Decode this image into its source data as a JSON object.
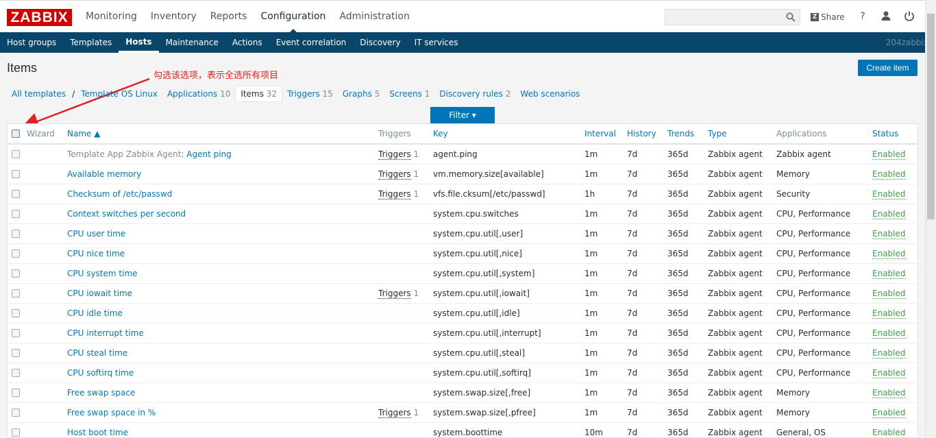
{
  "logo": "ZABBIX",
  "main_nav": [
    "Monitoring",
    "Inventory",
    "Reports",
    "Configuration",
    "Administration"
  ],
  "main_nav_active": "Configuration",
  "search": {
    "value": "",
    "placeholder": ""
  },
  "share_label": "Share",
  "help_label": "?",
  "sub_nav": [
    "Host groups",
    "Templates",
    "Hosts",
    "Maintenance",
    "Actions",
    "Event correlation",
    "Discovery",
    "IT services"
  ],
  "sub_nav_active": "Hosts",
  "server_name": "204zabbix",
  "page_title": "Items",
  "annotation": "勾选该选项，表示全选所有项目",
  "create_button": "Create item",
  "breadcrumb": {
    "all_templates": "All templates",
    "separator": "/",
    "template": "Template OS Linux"
  },
  "tabs": [
    {
      "label": "Applications",
      "count": "10"
    },
    {
      "label": "Items",
      "count": "32"
    },
    {
      "label": "Triggers",
      "count": "15"
    },
    {
      "label": "Graphs",
      "count": "5"
    },
    {
      "label": "Screens",
      "count": "1"
    },
    {
      "label": "Discovery rules",
      "count": "2"
    },
    {
      "label": "Web scenarios",
      "count": ""
    }
  ],
  "active_tab": "Items",
  "filter_label": "Filter ▾",
  "columns": {
    "wizard": "Wizard",
    "name": "Name ▲",
    "triggers": "Triggers",
    "key": "Key",
    "interval": "Interval",
    "history": "History",
    "trends": "Trends",
    "type": "Type",
    "applications": "Applications",
    "status": "Status"
  },
  "rows": [
    {
      "template": "Template App Zabbix Agent",
      "name": "Agent ping",
      "triggers": "Triggers",
      "trigger_count": "1",
      "key": "agent.ping",
      "interval": "1m",
      "history": "7d",
      "trends": "365d",
      "type": "Zabbix agent",
      "applications": "Zabbix agent",
      "status": "Enabled"
    },
    {
      "template": "",
      "name": "Available memory",
      "triggers": "Triggers",
      "trigger_count": "1",
      "key": "vm.memory.size[available]",
      "interval": "1m",
      "history": "7d",
      "trends": "365d",
      "type": "Zabbix agent",
      "applications": "Memory",
      "status": "Enabled"
    },
    {
      "template": "",
      "name": "Checksum of /etc/passwd",
      "triggers": "Triggers",
      "trigger_count": "1",
      "key": "vfs.file.cksum[/etc/passwd]",
      "interval": "1h",
      "history": "7d",
      "trends": "365d",
      "type": "Zabbix agent",
      "applications": "Security",
      "status": "Enabled"
    },
    {
      "template": "",
      "name": "Context switches per second",
      "triggers": "",
      "trigger_count": "",
      "key": "system.cpu.switches",
      "interval": "1m",
      "history": "7d",
      "trends": "365d",
      "type": "Zabbix agent",
      "applications": "CPU, Performance",
      "status": "Enabled"
    },
    {
      "template": "",
      "name": "CPU user time",
      "triggers": "",
      "trigger_count": "",
      "key": "system.cpu.util[,user]",
      "interval": "1m",
      "history": "7d",
      "trends": "365d",
      "type": "Zabbix agent",
      "applications": "CPU, Performance",
      "status": "Enabled"
    },
    {
      "template": "",
      "name": "CPU nice time",
      "triggers": "",
      "trigger_count": "",
      "key": "system.cpu.util[,nice]",
      "interval": "1m",
      "history": "7d",
      "trends": "365d",
      "type": "Zabbix agent",
      "applications": "CPU, Performance",
      "status": "Enabled"
    },
    {
      "template": "",
      "name": "CPU system time",
      "triggers": "",
      "trigger_count": "",
      "key": "system.cpu.util[,system]",
      "interval": "1m",
      "history": "7d",
      "trends": "365d",
      "type": "Zabbix agent",
      "applications": "CPU, Performance",
      "status": "Enabled"
    },
    {
      "template": "",
      "name": "CPU iowait time",
      "triggers": "Triggers",
      "trigger_count": "1",
      "key": "system.cpu.util[,iowait]",
      "interval": "1m",
      "history": "7d",
      "trends": "365d",
      "type": "Zabbix agent",
      "applications": "CPU, Performance",
      "status": "Enabled"
    },
    {
      "template": "",
      "name": "CPU idle time",
      "triggers": "",
      "trigger_count": "",
      "key": "system.cpu.util[,idle]",
      "interval": "1m",
      "history": "7d",
      "trends": "365d",
      "type": "Zabbix agent",
      "applications": "CPU, Performance",
      "status": "Enabled"
    },
    {
      "template": "",
      "name": "CPU interrupt time",
      "triggers": "",
      "trigger_count": "",
      "key": "system.cpu.util[,interrupt]",
      "interval": "1m",
      "history": "7d",
      "trends": "365d",
      "type": "Zabbix agent",
      "applications": "CPU, Performance",
      "status": "Enabled"
    },
    {
      "template": "",
      "name": "CPU steal time",
      "triggers": "",
      "trigger_count": "",
      "key": "system.cpu.util[,steal]",
      "interval": "1m",
      "history": "7d",
      "trends": "365d",
      "type": "Zabbix agent",
      "applications": "CPU, Performance",
      "status": "Enabled"
    },
    {
      "template": "",
      "name": "CPU softirq time",
      "triggers": "",
      "trigger_count": "",
      "key": "system.cpu.util[,softirq]",
      "interval": "1m",
      "history": "7d",
      "trends": "365d",
      "type": "Zabbix agent",
      "applications": "CPU, Performance",
      "status": "Enabled"
    },
    {
      "template": "",
      "name": "Free swap space",
      "triggers": "",
      "trigger_count": "",
      "key": "system.swap.size[,free]",
      "interval": "1m",
      "history": "7d",
      "trends": "365d",
      "type": "Zabbix agent",
      "applications": "Memory",
      "status": "Enabled"
    },
    {
      "template": "",
      "name": "Free swap space in %",
      "triggers": "Triggers",
      "trigger_count": "1",
      "key": "system.swap.size[,pfree]",
      "interval": "1m",
      "history": "7d",
      "trends": "365d",
      "type": "Zabbix agent",
      "applications": "Memory",
      "status": "Enabled"
    },
    {
      "template": "",
      "name": "Host boot time",
      "triggers": "",
      "trigger_count": "",
      "key": "system.boottime",
      "interval": "10m",
      "history": "7d",
      "trends": "365d",
      "type": "Zabbix agent",
      "applications": "General, OS",
      "status": "Enabled"
    }
  ]
}
